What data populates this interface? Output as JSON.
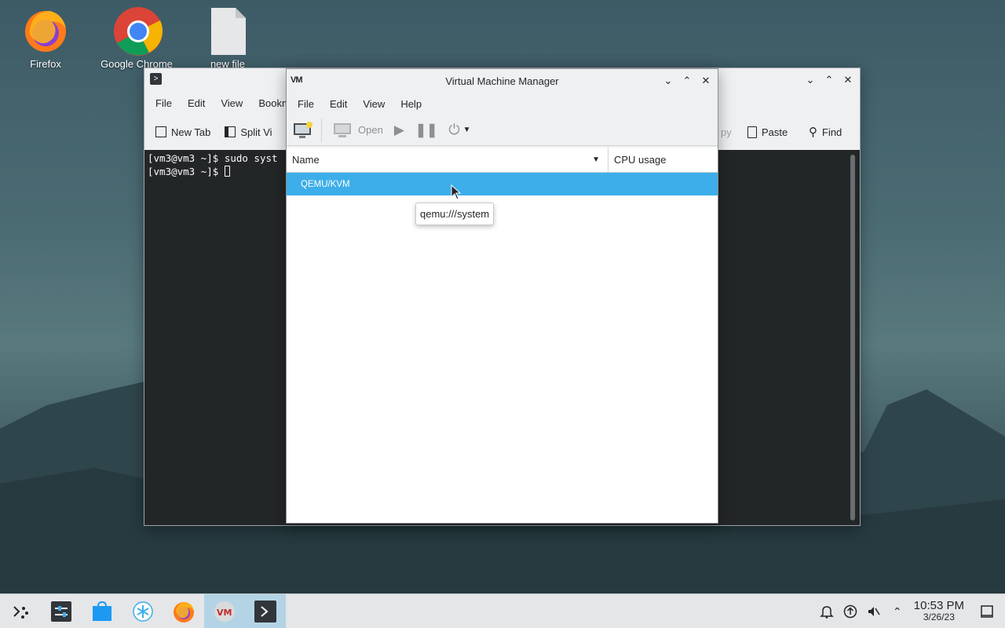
{
  "desktop": {
    "icons": [
      {
        "label": "Firefox",
        "icon": "firefox-icon"
      },
      {
        "label": "Google Chrome",
        "icon": "chrome-icon"
      },
      {
        "label": "new file",
        "icon": "file-icon"
      }
    ]
  },
  "terminal": {
    "menu": [
      "File",
      "Edit",
      "View",
      "Bookm"
    ],
    "toolbar": {
      "new_tab": "New Tab",
      "split_view": "Split Vi",
      "copy_partial": "py",
      "paste": "Paste",
      "find": "Find"
    },
    "lines": [
      "[vm3@vm3 ~]$ sudo syst",
      "[vm3@vm3 ~]$ "
    ]
  },
  "vmm": {
    "title": "Virtual Machine Manager",
    "menu": [
      "File",
      "Edit",
      "View",
      "Help"
    ],
    "toolbar": {
      "open": "Open"
    },
    "columns": {
      "name": "Name",
      "cpu": "CPU usage"
    },
    "rows": [
      {
        "name": "QEMU/KVM"
      }
    ],
    "tooltip": "qemu:///system"
  },
  "taskbar": {
    "time": "10:53 PM",
    "date": "3/26/23"
  },
  "colors": {
    "selection": "#3daee9",
    "terminal_bg": "#232627",
    "taskbar_bg": "#e4e6e8"
  }
}
